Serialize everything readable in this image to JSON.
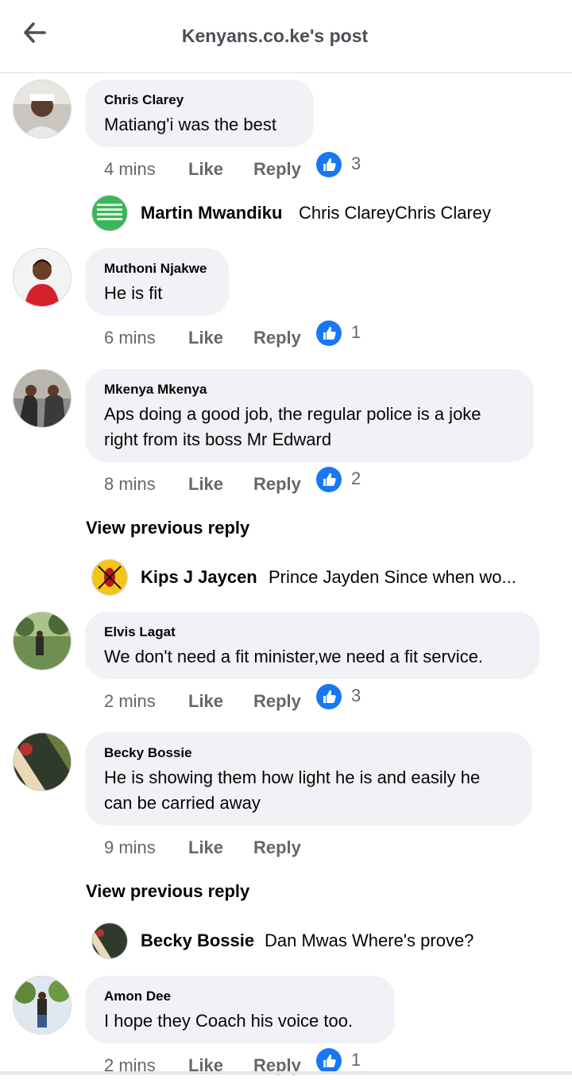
{
  "header": {
    "title": "Kenyans.co.ke's post",
    "back_icon": "arrow-left-icon"
  },
  "colors": {
    "accent": "#1877f2",
    "bubble": "#f0f2f5",
    "meta": "#65676b"
  },
  "comments": [
    {
      "author": "Chris Clarey",
      "text": "Matiang'i was the best",
      "time": "4 mins",
      "like": "Like",
      "reply": "Reply",
      "reactions": "3",
      "replies": [
        {
          "author": "Martin Mwandiku",
          "text": "Chris ClareyChris Clarey"
        }
      ]
    },
    {
      "author": "Muthoni Njakwe",
      "text": "He is fit",
      "time": "6 mins",
      "like": "Like",
      "reply": "Reply",
      "reactions": "1"
    },
    {
      "author": "Mkenya Mkenya",
      "text_lines": [
        "Aps doing a good job, the regular police is a joke",
        "right from its boss Mr Edward"
      ],
      "time": "8 mins",
      "like": "Like",
      "reply": "Reply",
      "reactions": "2",
      "view_previous": "View previous reply",
      "replies": [
        {
          "author": "Kips J Jaycen",
          "text": "Prince Jayden Since when wo..."
        }
      ]
    },
    {
      "author": "Elvis Lagat",
      "text": "We don't need a fit minister,we need a fit service.",
      "time": "2 mins",
      "like": "Like",
      "reply": "Reply",
      "reactions": "3"
    },
    {
      "author": "Becky Bossie",
      "text_lines": [
        "He is showing them how light he is and easily he",
        "can be carried away"
      ],
      "time": "9 mins",
      "like": "Like",
      "reply": "Reply",
      "view_previous": "View previous reply",
      "replies": [
        {
          "author": "Becky Bossie",
          "text": "Dan Mwas Where's prove?"
        }
      ]
    },
    {
      "author": "Amon Dee",
      "text": "I hope they Coach his voice too.",
      "time": "2 mins",
      "like": "Like",
      "reply": "Reply",
      "reactions": "1"
    }
  ]
}
